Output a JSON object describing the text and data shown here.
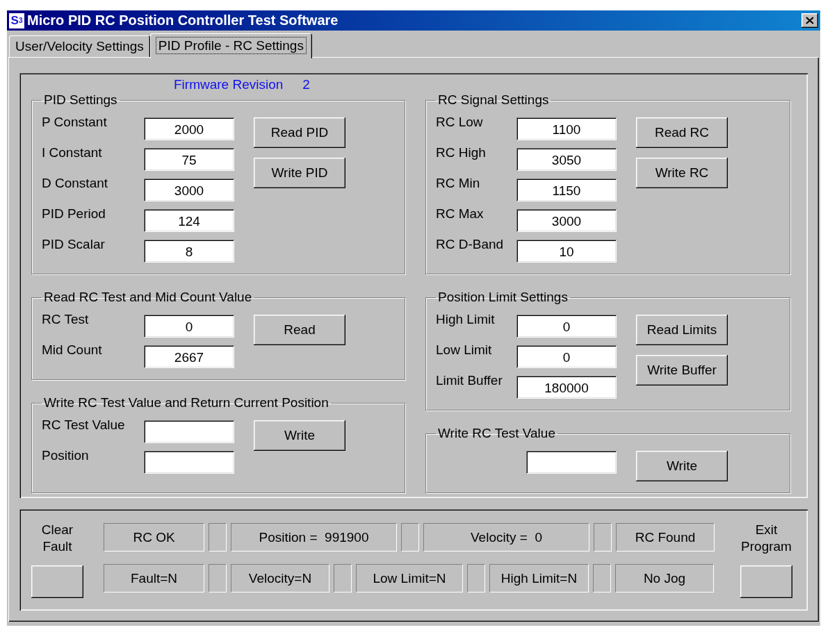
{
  "window": {
    "logo": "S$^{3}$",
    "title": "Micro PID RC Position Controller Test Software"
  },
  "tabs": [
    {
      "label": "User/Velocity Settings",
      "selected": false
    },
    {
      "label": "PID Profile - RC Settings",
      "selected": true
    }
  ],
  "firmware": {
    "label": "Firmware Revision",
    "value": "2"
  },
  "columns": [
    {
      "groups": [
        {
          "title": "PID Settings",
          "rows": [
            {
              "kind": "labeled",
              "label": "P Constant",
              "value": "2000"
            },
            {
              "kind": "labeled",
              "label": "I Constant",
              "value": "75"
            },
            {
              "kind": "labeled",
              "label": "D Constant",
              "value": "3000"
            },
            {
              "kind": "labeled",
              "label": "PID Period",
              "value": "124"
            },
            {
              "kind": "labeled",
              "label": "PID Scalar",
              "value": "8"
            }
          ],
          "buttons": [
            "Read PID",
            "Write PID"
          ]
        },
        {
          "title": "Read RC Test and Mid Count Value",
          "rows": [
            {
              "kind": "labeled",
              "label": "RC Test",
              "value": "0"
            },
            {
              "kind": "labeled",
              "label": "Mid Count",
              "value": "2667"
            }
          ],
          "buttons": [
            "Read"
          ]
        },
        {
          "title": "Write RC Test Value and Return Current Position",
          "rows": [
            {
              "kind": "labeled",
              "label": "RC Test Value"
            },
            {
              "kind": "labeled",
              "label": "Position"
            }
          ],
          "buttons": [
            "Write"
          ]
        }
      ]
    },
    {
      "groups": [
        {
          "title": "RC Signal Settings",
          "rows": [
            {
              "kind": "labeled",
              "label": "RC Low",
              "value": "1100"
            },
            {
              "kind": "labeled",
              "label": "RC High",
              "value": "3050"
            },
            {
              "kind": "labeled",
              "label": "RC Min",
              "value": "1150"
            },
            {
              "kind": "labeled",
              "label": "RC Max",
              "value": "3000"
            },
            {
              "kind": "labeled",
              "label": "RC D-Band",
              "value": "10"
            }
          ],
          "buttons": [
            "Read RC",
            "Write RC"
          ]
        },
        {
          "title": "Position Limit Settings",
          "rows": [
            {
              "kind": "labeled",
              "label": "High Limit",
              "value": "0"
            },
            {
              "kind": "labeled",
              "label": "Low Limit",
              "value": "0"
            },
            {
              "kind": "labeled",
              "label": "Limit Buffer",
              "value": "180000"
            }
          ],
          "buttons": [
            "Read Limits",
            "Write Buffer"
          ]
        },
        {
          "title": "Write RC Test Value",
          "rows": [
            {
              "kind": "field"
            }
          ],
          "buttons": [
            "Write"
          ]
        }
      ]
    }
  ],
  "status_bar": {
    "clear_label": "Clear Fault",
    "exit_label": "Exit Program",
    "rows": [
      {
        "items": [
          {
            "kind": "panel",
            "text": "RC OK"
          },
          {
            "kind": "lamp"
          },
          {
            "kind": "panel",
            "text": "Position =  991900"
          },
          {
            "kind": "lamp"
          },
          {
            "kind": "panel",
            "text": "Velocity =  0"
          },
          {
            "kind": "lamp"
          },
          {
            "kind": "panel",
            "text": "RC Found"
          }
        ]
      },
      {
        "items": [
          {
            "kind": "panel",
            "text": "Fault=N"
          },
          {
            "kind": "lamp"
          },
          {
            "kind": "panel",
            "text": "Velocity=N"
          },
          {
            "kind": "lamp"
          },
          {
            "kind": "panel",
            "text": "Low Limit=N"
          },
          {
            "kind": "lamp"
          },
          {
            "kind": "panel",
            "text": "High Limit=N"
          },
          {
            "kind": "lamp"
          },
          {
            "kind": "panel",
            "text": "No Jog"
          }
        ]
      }
    ]
  }
}
